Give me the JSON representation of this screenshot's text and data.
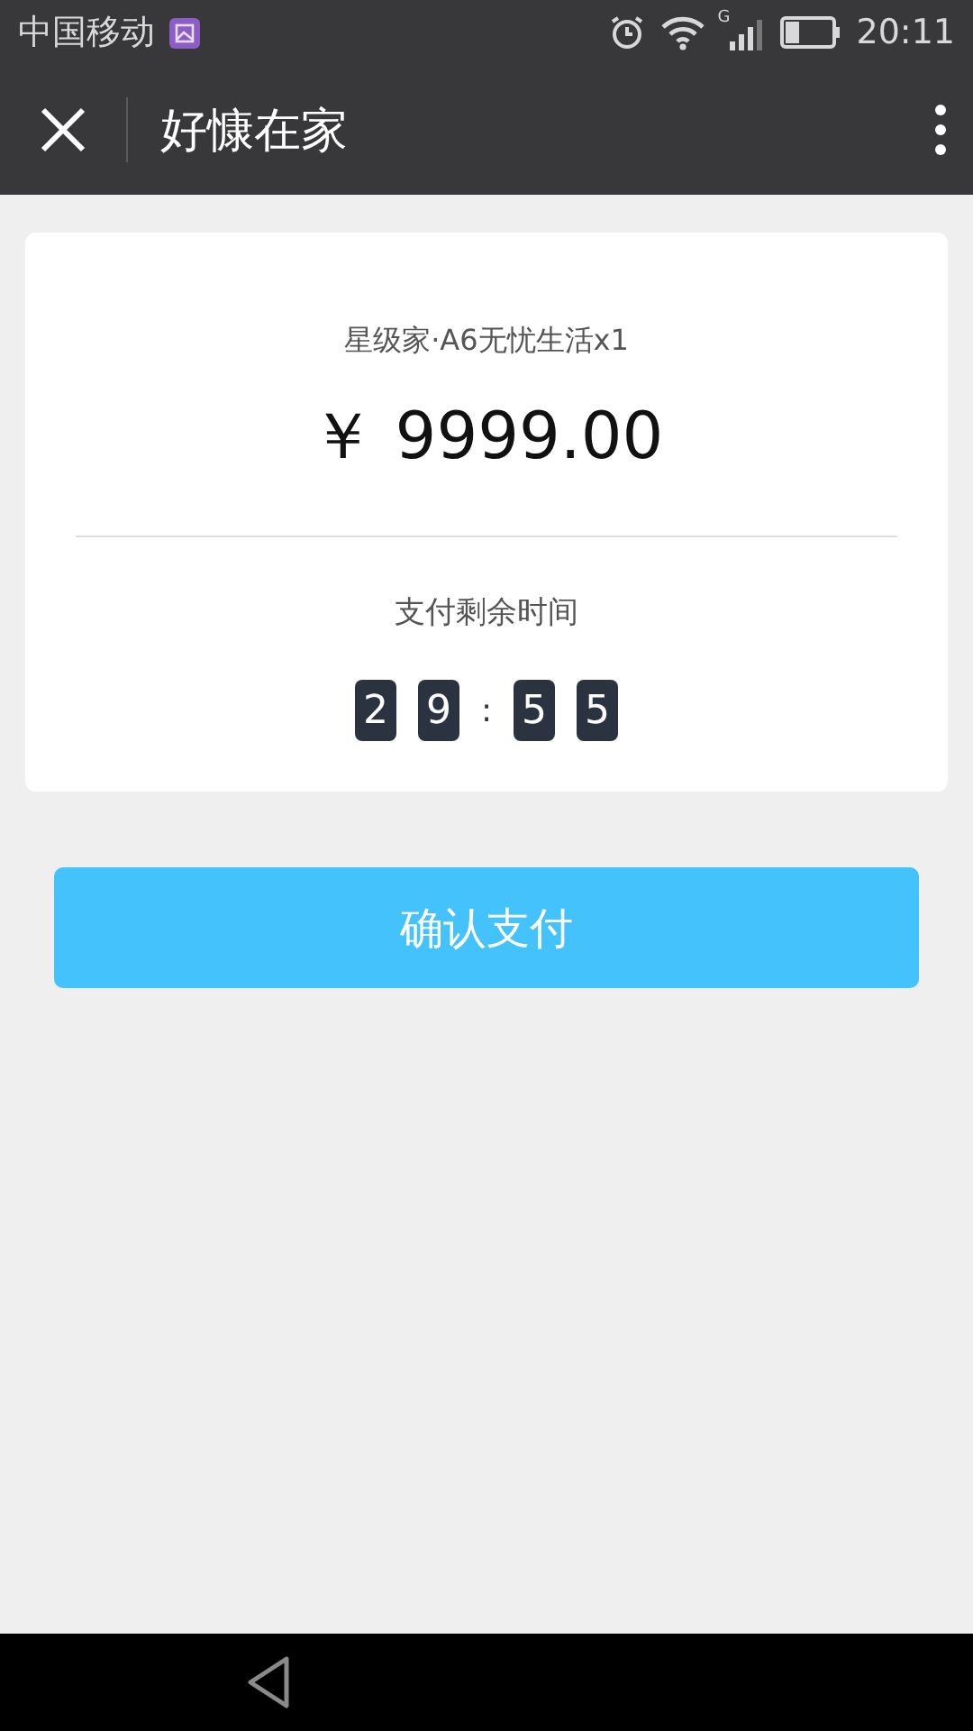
{
  "status_bar": {
    "carrier": "中国移动",
    "network_label": "G",
    "time": "20:11"
  },
  "header": {
    "title": "好慷在家"
  },
  "order": {
    "product": "星级家·A6无忧生活x1",
    "price": "￥ 9999.00",
    "countdown_label": "支付剩余时间",
    "countdown": [
      {
        "kind": "digit",
        "text": "2"
      },
      {
        "kind": "digit",
        "text": "9"
      },
      {
        "kind": "separator",
        "text": ":"
      },
      {
        "kind": "digit",
        "text": "5"
      },
      {
        "kind": "digit",
        "text": "5"
      }
    ]
  },
  "confirm_button": "确认支付"
}
